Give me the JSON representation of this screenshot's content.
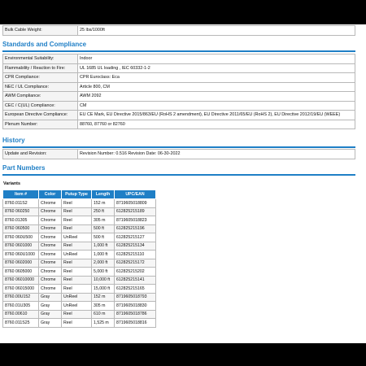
{
  "top_table": [
    {
      "key": "Bulk Cable Weight:",
      "value": "25 lbs/1000ft"
    }
  ],
  "standards": {
    "title": "Standards and Compliance",
    "rows": [
      {
        "key": "Environmental Suitability:",
        "value": "Indoor"
      },
      {
        "key": "Flammability / Reaction to Fire:",
        "value": "UL 1685 UL loading , IEC 60332-1-2"
      },
      {
        "key": "CPR Compliance:",
        "value": "CPR Euroclass: Eca"
      },
      {
        "key": "NEC / UL Compliance:",
        "value": "Article 800, CM"
      },
      {
        "key": "AWM Compliance:",
        "value": "AWM 2092"
      },
      {
        "key": "CEC / C(UL) Compliance:",
        "value": "CM"
      },
      {
        "key": "European Directive Compliance:",
        "value": "EU CE Mark, EU Directive 2015/863/EU (RoHS 2 amendment), EU Directive 2011/65/EU (RoHS 2), EU Directive 2012/19/EU (WEEE)"
      },
      {
        "key": "Plenum Number:",
        "value": "88760, 87760 or 82760"
      }
    ]
  },
  "history": {
    "title": "History",
    "rows": [
      {
        "key": "Update and Revision:",
        "value": "Revision Number: 0.516 Revision Date: 06-30-2022"
      }
    ]
  },
  "part_numbers": {
    "title": "Part Numbers",
    "variants_label": "Variants",
    "headers": [
      "Item #",
      "Color",
      "Putup Type",
      "Length",
      "UPC/EAN"
    ],
    "rows": [
      [
        "8760.011S2",
        "Chrome",
        "Reel",
        "152 m",
        "8719605018809"
      ],
      [
        "8760 060250",
        "Chrome",
        "Reel",
        "250 ft",
        "612825215189"
      ],
      [
        "8760.01305",
        "Chrome",
        "Reel",
        "305 m",
        "8719605018823"
      ],
      [
        "8760 060500",
        "Chrome",
        "Reel",
        "500 ft",
        "612825215196"
      ],
      [
        "8760 060U500",
        "Chrome",
        "UnReel",
        "500 ft",
        "612825215127"
      ],
      [
        "8760 0601000",
        "Chrome",
        "Reel",
        "1,000 ft",
        "612825215134"
      ],
      [
        "8760 060U1000",
        "Chrome",
        "UnReel",
        "1,000 ft",
        "612825215110"
      ],
      [
        "8760 0602000",
        "Chrome",
        "Reel",
        "2,000 ft",
        "612825215172"
      ],
      [
        "8760 0605000",
        "Chrome",
        "Reel",
        "5,000 ft",
        "612825215202"
      ],
      [
        "8760 06010000",
        "Chrome",
        "Reel",
        "10,000 ft",
        "612825215141"
      ],
      [
        "8760 06015000",
        "Chrome",
        "Reel",
        "15,000 ft",
        "612825215165"
      ],
      [
        "8760.00U152",
        "Gray",
        "UnReel",
        "152 m",
        "8719605018793"
      ],
      [
        "8760.01U305",
        "Gray",
        "UnReel",
        "305 m",
        "8719605018830"
      ],
      [
        "8760.00610",
        "Gray",
        "Reel",
        "610 m",
        "8719605018786"
      ],
      [
        "8760.011S25",
        "Gray",
        "Reel",
        "1,525 m",
        "8719605018816"
      ]
    ]
  }
}
